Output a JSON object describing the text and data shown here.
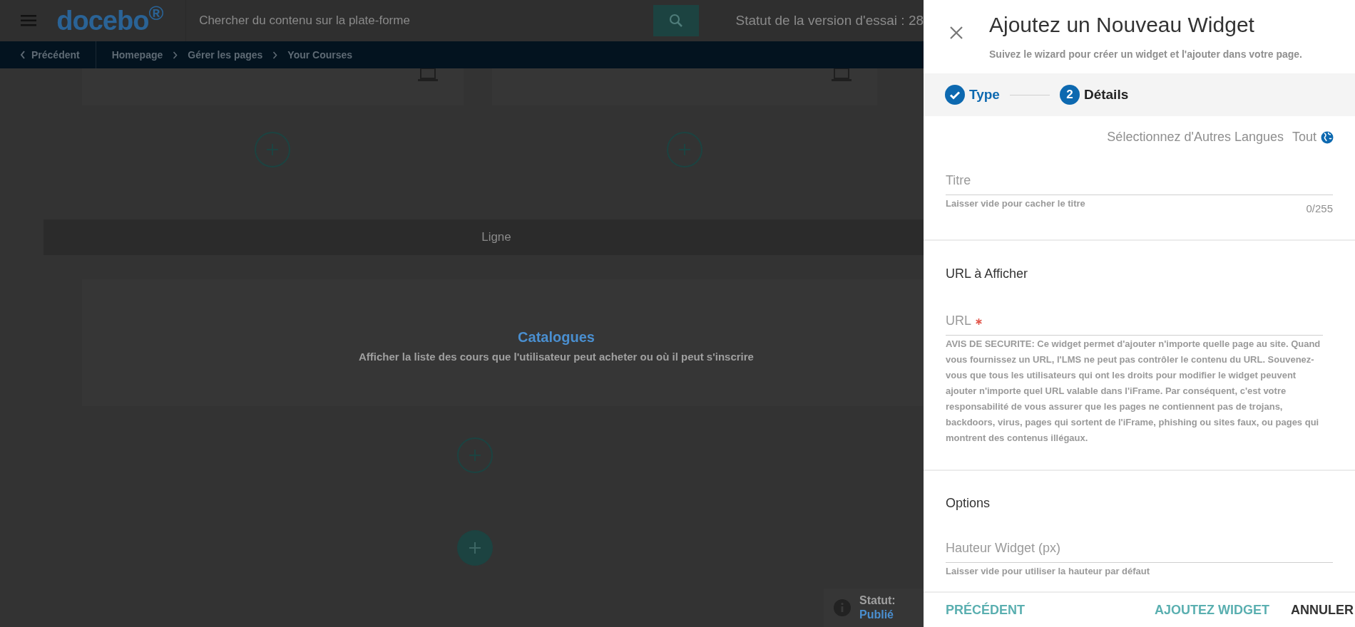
{
  "header": {
    "logo": "docebo$^{®}$",
    "search": {
      "placeholder": "Chercher du contenu sur la plate-forme"
    },
    "trial_status": "Statut de la version d'essai : 28"
  },
  "breadcrumb": {
    "back": "Précédent",
    "items": [
      "Homepage",
      "Gérer les pages",
      "Your Courses"
    ]
  },
  "canvas": {
    "row_label": "Ligne",
    "catalog_widget": {
      "title": "Catalogues",
      "description": "Afficher la liste des cours que l'utilisateur peut acheter ou où il peut s'inscrire"
    },
    "status": {
      "label": "Statut:",
      "value": "Publié"
    }
  },
  "panel": {
    "title": "Ajoutez un Nouveau Widget",
    "subtitle": "Suivez le wizard pour créer un widget et l'ajouter dans votre page.",
    "steps": [
      {
        "label": "Type",
        "completed": true
      },
      {
        "label": "Détails",
        "number": "2",
        "completed": false
      }
    ],
    "languages": {
      "label": "Sélectionnez d'Autres Langues",
      "value": "Tout"
    },
    "title_field": {
      "placeholder": "Titre",
      "helper": "Laisser vide pour cacher le titre",
      "counter": "0/255"
    },
    "url_section": {
      "heading": "URL à Afficher",
      "field": {
        "placeholder": "URL",
        "required": true
      },
      "notice": "AVIS DE SECURITE: Ce widget permet d'ajouter n'importe quelle page au site. Quand vous fournissez un URL, l'LMS ne peut pas contrôler le contenu du URL. Souvenez-vous que tous les utilisateurs qui ont les droits pour modifier le widget peuvent ajouter n'importe quel URL valable dans l'iFrame. Par conséquent, c'est votre responsabilité de vous assurer que les pages ne contiennent pas de trojans, backdoors, virus, pages qui sortent de l'iFrame, phishing ou sites faux, ou pages qui montrent des contenus illégaux."
    },
    "options_section": {
      "heading": "Options",
      "field": {
        "placeholder": "Hauteur Widget (px)",
        "helper": "Laisser vide pour utiliser la hauteur par défaut"
      }
    },
    "buttons": [
      {
        "label": "PRÉCÉDENT",
        "kind": "back"
      },
      {
        "label": "AJOUTEZ WIDGET",
        "kind": "primary"
      },
      {
        "label": "ANNULER",
        "kind": "cancel"
      }
    ]
  }
}
